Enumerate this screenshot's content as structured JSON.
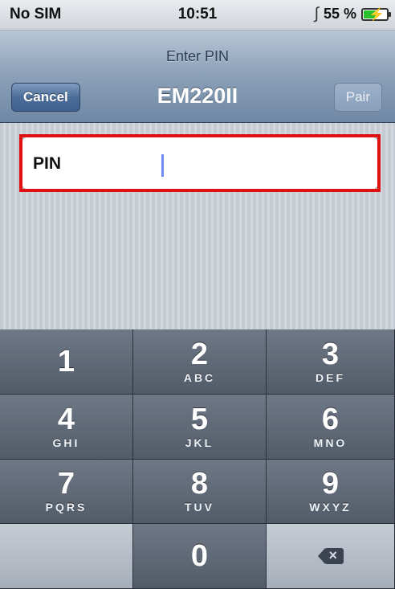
{
  "status_bar": {
    "carrier": "No SIM",
    "time": "10:51",
    "bluetooth_icon": "bluetooth-icon",
    "battery_percent": "55 %",
    "battery_level": 0.55,
    "battery_icon": "battery-charging-icon"
  },
  "nav": {
    "prompt": "Enter PIN",
    "title": "EM220II",
    "cancel_label": "Cancel",
    "pair_label": "Pair"
  },
  "form": {
    "pin_label": "PIN",
    "pin_value": ""
  },
  "keypad": {
    "keys": [
      {
        "num": "1",
        "letters": ""
      },
      {
        "num": "2",
        "letters": "ABC"
      },
      {
        "num": "3",
        "letters": "DEF"
      },
      {
        "num": "4",
        "letters": "GHI"
      },
      {
        "num": "5",
        "letters": "JKL"
      },
      {
        "num": "6",
        "letters": "MNO"
      },
      {
        "num": "7",
        "letters": "PQRS"
      },
      {
        "num": "8",
        "letters": "TUV"
      },
      {
        "num": "9",
        "letters": "WXYZ"
      },
      {
        "num": "0",
        "letters": ""
      }
    ],
    "delete_icon": "backspace-icon"
  },
  "colors": {
    "highlight": "#e01010",
    "caret": "#6f8df0",
    "battery_fill": "#2bc02b"
  }
}
